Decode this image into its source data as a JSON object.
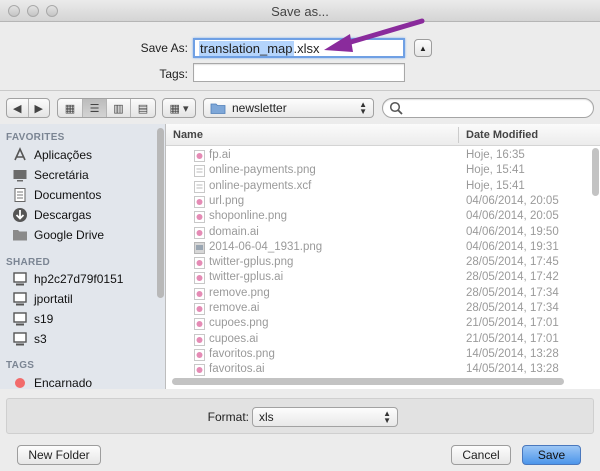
{
  "window": {
    "title": "Save as..."
  },
  "save_as": {
    "label": "Save As:",
    "filename_base": "translation_map",
    "filename_ext": ".xlsx",
    "expand_symbol": "▲"
  },
  "tags": {
    "label": "Tags:",
    "value": ""
  },
  "toolbar": {
    "back": "◀",
    "forward": "▶",
    "view_icon": "▦",
    "view_list": "☰",
    "view_columns": "▥",
    "view_coverflow": "▤",
    "arrange": "▦ ▾",
    "location": "newsletter",
    "search_placeholder": ""
  },
  "sidebar": {
    "favorites_heading": "FAVORITES",
    "favorites": [
      {
        "label": "Aplicações",
        "icon": "applications-icon"
      },
      {
        "label": "Secretária",
        "icon": "desktop-icon"
      },
      {
        "label": "Documentos",
        "icon": "documents-icon"
      },
      {
        "label": "Descargas",
        "icon": "downloads-icon"
      },
      {
        "label": "Google Drive",
        "icon": "folder-icon"
      }
    ],
    "shared_heading": "SHARED",
    "shared": [
      {
        "label": "hp2c27d79f0151",
        "icon": "computer-icon"
      },
      {
        "label": "jportatil",
        "icon": "computer-icon"
      },
      {
        "label": "s19",
        "icon": "computer-icon"
      },
      {
        "label": "s3",
        "icon": "computer-icon"
      }
    ],
    "tags_heading": "TAGS",
    "tags": [
      {
        "label": "Encarnado",
        "color": "#f26b6b"
      }
    ]
  },
  "files": {
    "col_name": "Name",
    "col_date": "Date Modified",
    "rows": [
      {
        "name": "fp.ai",
        "date": "Hoje, 16:35",
        "kind": "ai"
      },
      {
        "name": "online-payments.png",
        "date": "Hoje, 15:41",
        "kind": "doc"
      },
      {
        "name": "online-payments.xcf",
        "date": "Hoje, 15:41",
        "kind": "doc"
      },
      {
        "name": "url.png",
        "date": "04/06/2014, 20:05",
        "kind": "ai"
      },
      {
        "name": "shoponline.png",
        "date": "04/06/2014, 20:05",
        "kind": "ai"
      },
      {
        "name": "domain.ai",
        "date": "04/06/2014, 19:50",
        "kind": "ai"
      },
      {
        "name": "2014-06-04_1931.png",
        "date": "04/06/2014, 19:31",
        "kind": "img"
      },
      {
        "name": "twitter-gplus.png",
        "date": "28/05/2014, 17:45",
        "kind": "ai"
      },
      {
        "name": "twitter-gplus.ai",
        "date": "28/05/2014, 17:42",
        "kind": "ai"
      },
      {
        "name": "remove.png",
        "date": "28/05/2014, 17:34",
        "kind": "ai"
      },
      {
        "name": "remove.ai",
        "date": "28/05/2014, 17:34",
        "kind": "ai"
      },
      {
        "name": "cupoes.png",
        "date": "21/05/2014, 17:01",
        "kind": "ai"
      },
      {
        "name": "cupoes.ai",
        "date": "21/05/2014, 17:01",
        "kind": "ai"
      },
      {
        "name": "favoritos.png",
        "date": "14/05/2014, 13:28",
        "kind": "ai"
      },
      {
        "name": "favoritos.ai",
        "date": "14/05/2014, 13:28",
        "kind": "ai"
      }
    ]
  },
  "format": {
    "label": "Format:",
    "value": "xls"
  },
  "buttons": {
    "new_folder": "New Folder",
    "cancel": "Cancel",
    "save": "Save"
  },
  "colors": {
    "accent": "#4c95ea",
    "selection": "#b4d4fc",
    "annotation_arrow": "#8a2b9c"
  }
}
